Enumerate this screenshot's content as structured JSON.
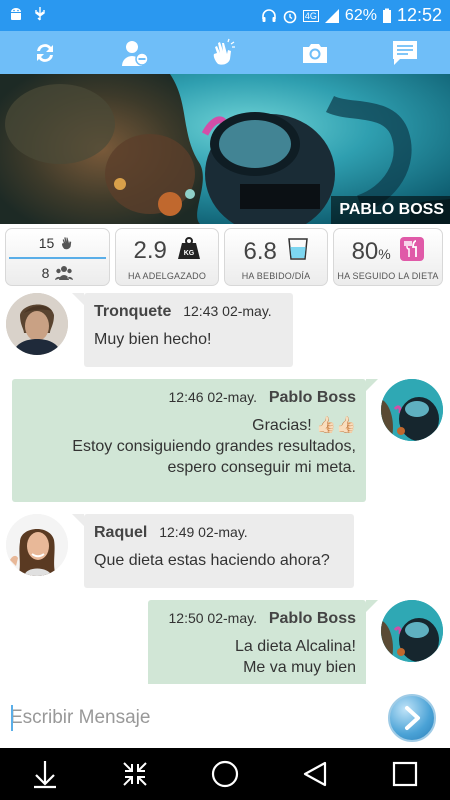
{
  "status_bar": {
    "battery": "62%",
    "time": "12:52",
    "network": "4G"
  },
  "toolbar": {
    "icons": [
      "refresh-icon",
      "remove-user-icon",
      "clap-icon",
      "camera-icon",
      "chat-icon"
    ]
  },
  "banner": {
    "name": "PABLO BOSS"
  },
  "stats": {
    "claps": "15",
    "people": "8",
    "weight_lost": "2.9",
    "weight_unit": "KG",
    "weight_label": "HA ADELGAZADO",
    "water": "6.8",
    "water_label": "HA BEBIDO/DÍA",
    "diet": "80",
    "diet_unit": "%",
    "diet_label": "HA SEGUIDO LA DIETA"
  },
  "messages": [
    {
      "author": "Tronquete",
      "time": "12:43 02-may.",
      "text": "Muy bien hecho!"
    },
    {
      "author": "Pablo Boss",
      "time": "12:46 02-may.",
      "line1": "Gracias! 👍🏻👍🏻",
      "line2": "Estoy consiguiendo grandes resultados,",
      "line3": "espero conseguir mi meta."
    },
    {
      "author": "Raquel",
      "time": "12:49 02-may.",
      "text": "Que dieta estas haciendo ahora?"
    },
    {
      "author": "Pablo Boss",
      "time": "12:50 02-may.",
      "line1": "La dieta Alcalina!",
      "line2": "Me va muy bien"
    }
  ],
  "composer": {
    "placeholder": "Escribir Mensaje"
  },
  "colors": {
    "status": "#2a98f0",
    "toolbar": "#6fbef8",
    "incoming": "#ececec",
    "outgoing": "#d1e6d6"
  }
}
